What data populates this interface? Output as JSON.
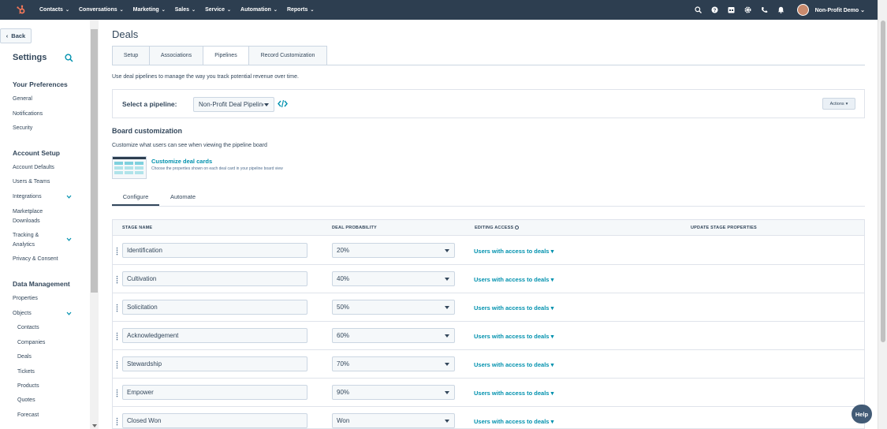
{
  "topnav": {
    "items": [
      "Contacts",
      "Conversations",
      "Marketing",
      "Sales",
      "Service",
      "Automation",
      "Reports"
    ],
    "account": "Non-Profit Demo"
  },
  "sidebar": {
    "back": "Back",
    "title": "Settings",
    "sections": {
      "preferences": {
        "title": "Your Preferences",
        "items": [
          "General",
          "Notifications",
          "Security"
        ]
      },
      "account": {
        "title": "Account Setup",
        "items": [
          "Account Defaults",
          "Users & Teams",
          "Integrations",
          "Marketplace",
          "Downloads",
          "Tracking &",
          "Analytics",
          "Privacy & Consent"
        ]
      },
      "data": {
        "title": "Data Management",
        "items": [
          "Properties",
          "Objects"
        ],
        "objects": [
          "Contacts",
          "Companies",
          "Deals",
          "Tickets",
          "Products",
          "Quotes",
          "Forecast"
        ]
      }
    }
  },
  "main": {
    "title": "Deals",
    "tabs": [
      "Setup",
      "Associations",
      "Pipelines",
      "Record Customization"
    ],
    "description": "Use deal pipelines to manage the way you track potential revenue over time.",
    "pipeline_label": "Select a pipeline:",
    "pipeline_value": "Non-Profit Deal Pipeline",
    "actions": "Actions",
    "board_title": "Board customization",
    "board_desc": "Customize what users can see when viewing the pipeline board",
    "customize_link": "Customize deal cards",
    "customize_sub": "Choose the properties shown on each deal card in your pipeline board view",
    "subtabs": [
      "Configure",
      "Automate"
    ],
    "columns": [
      "STAGE NAME",
      "DEAL PROBABILITY",
      "EDITING ACCESS",
      "UPDATE STAGE PROPERTIES"
    ],
    "access_label": "Users with access to deals",
    "rows": [
      {
        "stage": "Identification",
        "prob": "20%"
      },
      {
        "stage": "Cultivation",
        "prob": "40%"
      },
      {
        "stage": "Solicitation",
        "prob": "50%"
      },
      {
        "stage": "Acknowledgement",
        "prob": "60%"
      },
      {
        "stage": "Stewardship",
        "prob": "70%"
      },
      {
        "stage": "Empower",
        "prob": "90%"
      },
      {
        "stage": "Closed Won",
        "prob": "Won"
      }
    ]
  },
  "help": "Help",
  "colors": {
    "nav": "#2d3e50",
    "link": "#0091ae",
    "text": "#33475b",
    "hubspot": "#ff7a59"
  }
}
